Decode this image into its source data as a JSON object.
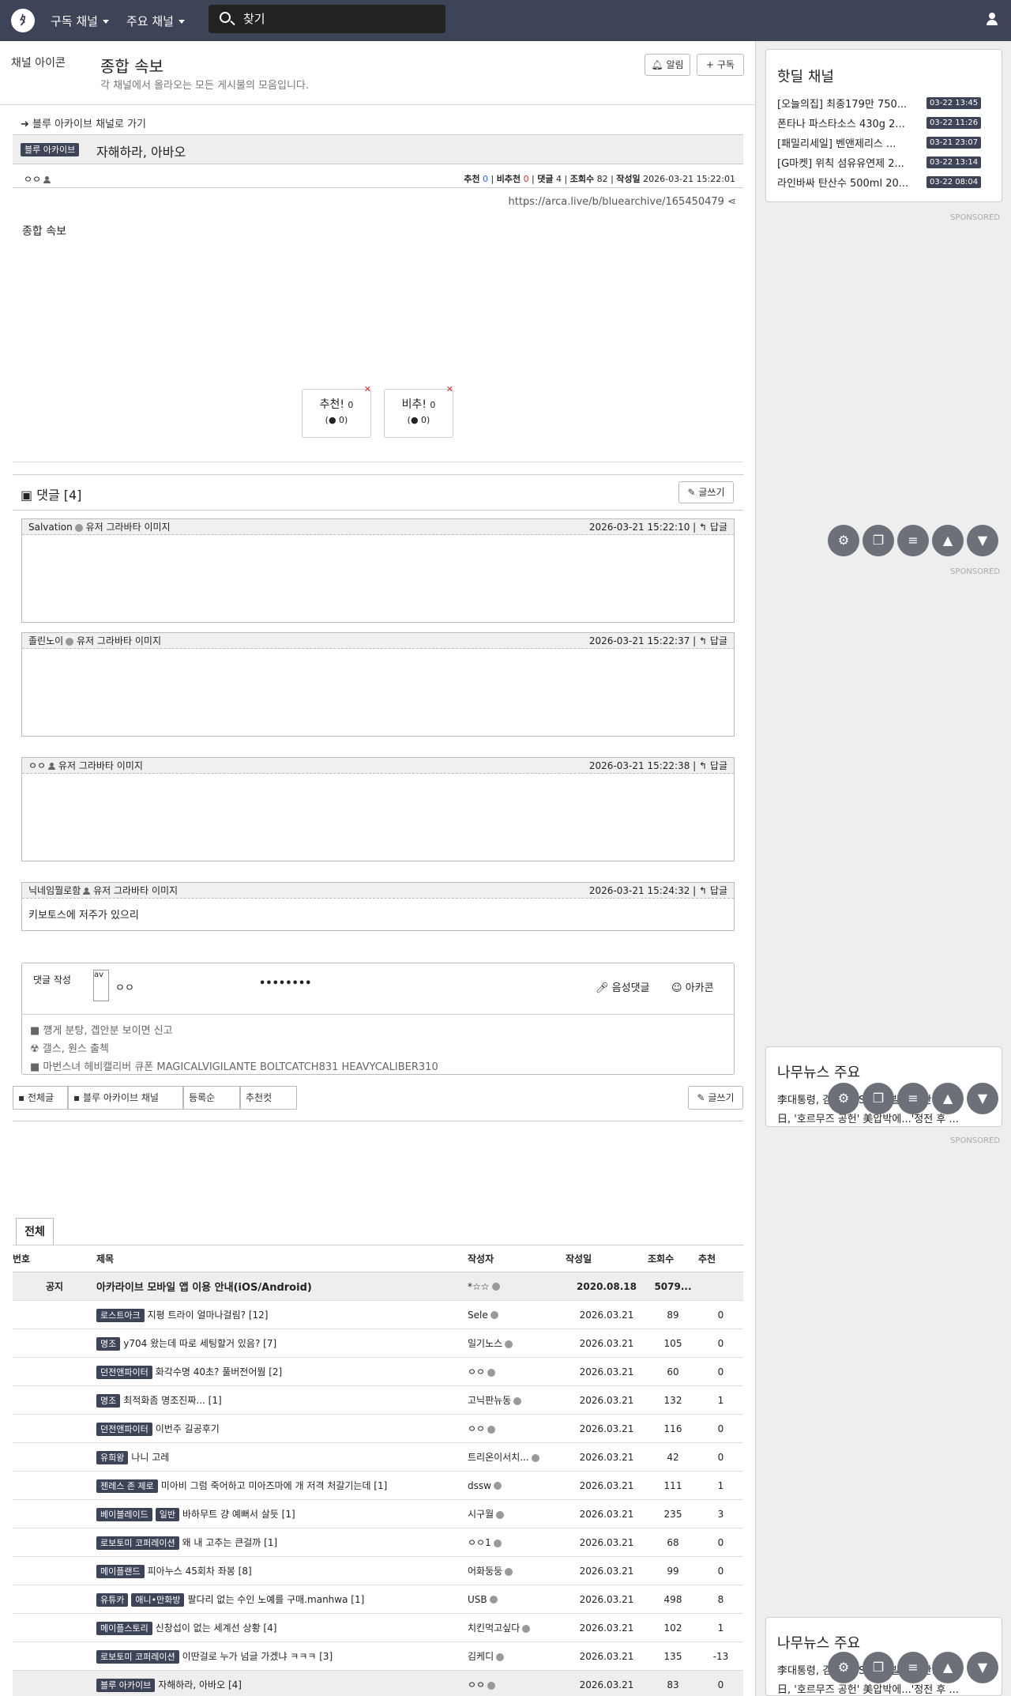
{
  "nav": {
    "menu1": "구독 채널",
    "menu2": "주요 채널",
    "search_placeholder": "찾기"
  },
  "board": {
    "channel_icon_alt": "채널 아이콘",
    "title": "종합 속보",
    "desc": "각 채널에서 올라오는 모든 게시물의 모음입니다.",
    "alarm": "알림",
    "subscribe": "구독"
  },
  "post": {
    "goto": "블루 아카이브 채널로 가기",
    "category": "블루 아카이브",
    "title": "자해하라, 아바오",
    "author": "ㅇㅇ",
    "stats": {
      "rec_label": "추천",
      "rec": "0",
      "unrec_label": "비추천",
      "unrec": "0",
      "comments_label": "댓글",
      "comments": "4",
      "views_label": "조회수",
      "views": "82",
      "date_label": "작성일",
      "date": "2026-03-21 15:22:01"
    },
    "url": "https://arca.live/b/bluearchive/165450479",
    "image_alt": "종합 속보",
    "vote_up": "추천!",
    "vote_up_count": "0",
    "vote_up_sub": "0",
    "vote_down": "비추!",
    "vote_down_count": "0",
    "vote_down_sub": "0"
  },
  "comments": {
    "header": "댓글 [4]",
    "write": "글쓰기",
    "items": [
      {
        "author": "Salvation",
        "avatar_alt": "유저 그라바타 이미지",
        "date": "2026-03-21 15:22:10",
        "reply": "답글",
        "body": ""
      },
      {
        "author": "졸린노이",
        "avatar_alt": "유저 그라바타 이미지",
        "date": "2026-03-21 15:22:37",
        "reply": "답글",
        "body": ""
      },
      {
        "author": "ㅇㅇ",
        "avatar_alt": "유저 그라바타 이미지",
        "date": "2026-03-21 15:22:38",
        "reply": "답글",
        "body": ""
      },
      {
        "author": "닉네임뭘로함",
        "avatar_alt": "유저 그라바타 이미지",
        "date": "2026-03-21 15:24:32",
        "reply": "답글",
        "body": "키보토스에 저주가 있으리"
      }
    ],
    "composer": {
      "label": "댓글 작성",
      "avatar_alt": "av",
      "nick": "ㅇㅇ",
      "password": "••••••••",
      "voice": "음성댓글",
      "arcacon": "아카콘",
      "rules": [
        "■ 꺵게 분탕, 곕안분 보이면 신고",
        "☢ 갤스, 원스 출첵",
        "■ 마번스녀 헤비캘리버 큐폰 MAGICALVIGILANTE BOLTCATCH831 HEAVYCALIBER310"
      ]
    }
  },
  "list_tabs": {
    "all": "전체글",
    "channel": "블루 아카이브 채널",
    "sort": "등록순",
    "best": "추천컷",
    "write": "글쓰기"
  },
  "list": {
    "tab": "전체",
    "headers": {
      "no": "번호",
      "title": "제목",
      "author": "작성자",
      "date": "작성일",
      "views": "조회수",
      "rec": "추천"
    },
    "rows": [
      {
        "no": "공지",
        "badges": [],
        "title": "아카라이브 모바일 앱 이용 안내(iOS/Android)",
        "author": "*☆☆",
        "date": "2020.08.18",
        "views": "5079...",
        "rec": ""
      },
      {
        "no": "",
        "badges": [
          "로스트아크"
        ],
        "title": "지평 트라이 얼마나걸림? [12]",
        "author": "Sele",
        "date": "2026.03.21",
        "views": "89",
        "rec": "0"
      },
      {
        "no": "",
        "badges": [
          "명조"
        ],
        "title": "y704 왔는데 따로 세팅할거 있음? [7]",
        "author": "일기노스",
        "date": "2026.03.21",
        "views": "105",
        "rec": "0"
      },
      {
        "no": "",
        "badges": [
          "던전앤파이터"
        ],
        "title": "화각수명 40초? 풀버전어뭠 [2]",
        "author": "ㅇㅇ",
        "date": "2026.03.21",
        "views": "60",
        "rec": "0"
      },
      {
        "no": "",
        "badges": [
          "명조"
        ],
        "title": "최적화좀 명조진짜... [1]",
        "author": "고닉판뉴동",
        "date": "2026.03.21",
        "views": "132",
        "rec": "1"
      },
      {
        "no": "",
        "badges": [
          "던전앤파이터"
        ],
        "title": "이번주 길공후기",
        "author": "ㅇㅇ",
        "date": "2026.03.21",
        "views": "116",
        "rec": "0"
      },
      {
        "no": "",
        "badges": [
          "유희왕"
        ],
        "title": "나니 고레",
        "author": "트리온이서치...",
        "date": "2026.03.21",
        "views": "42",
        "rec": "0"
      },
      {
        "no": "",
        "badges": [
          "젠레스 존 제로"
        ],
        "title": "미아비 그럼 죽어하고 미아즈마에 개 저격 처갈기는데 [1]",
        "author": "dssw",
        "date": "2026.03.21",
        "views": "111",
        "rec": "1"
      },
      {
        "no": "",
        "badges": [
          "베이블레이드",
          "일반"
        ],
        "title": "바하무트 걍 예뻐서 살듯 [1]",
        "author": "시구월",
        "date": "2026.03.21",
        "views": "235",
        "rec": "3"
      },
      {
        "no": "",
        "badges": [
          "로보토미 코퍼레이션"
        ],
        "title": "왜 내 고추는 큰걸까 [1]",
        "author": "ㅇㅇ1",
        "date": "2026.03.21",
        "views": "68",
        "rec": "0"
      },
      {
        "no": "",
        "badges": [
          "메이플랜드"
        ],
        "title": "피아누스 45회차 좌봉 [8]",
        "author": "어화둥둥",
        "date": "2026.03.21",
        "views": "99",
        "rec": "0"
      },
      {
        "no": "",
        "badges": [
          "유튜카",
          "애니•만화방"
        ],
        "title": "팔다리 없는 수인 노예를 구매.manhwa [1]",
        "author": "USB",
        "date": "2026.03.21",
        "views": "498",
        "rec": "8"
      },
      {
        "no": "",
        "badges": [
          "메이플스토리"
        ],
        "title": "신창섭이 없는 세계선 상황 [4]",
        "author": "치킨먹고싶다",
        "date": "2026.03.21",
        "views": "102",
        "rec": "1"
      },
      {
        "no": "",
        "badges": [
          "로보토미 코퍼레이션"
        ],
        "title": "이딴걸로 누가 넘글 가겠냐 ㅋㅋㅋ [3]",
        "author": "김케디",
        "date": "2026.03.21",
        "views": "135",
        "rec": "-13"
      },
      {
        "no": "",
        "badges": [
          "블루 아카이브"
        ],
        "title": "자해하라, 아바오 [4]",
        "author": "ㅇㅇ",
        "date": "2026.03.21",
        "views": "83",
        "rec": "0"
      }
    ]
  },
  "sidebar": {
    "hot_title": "핫딜 채널",
    "hot": [
      {
        "title": "[오늘의집] 최종179만 750...",
        "time": "03-22 13:45"
      },
      {
        "title": "폰타나 파스타소스 430g 2...",
        "time": "03-22 11:26"
      },
      {
        "title": "[패밀리세일] 벤앤제리스 ...",
        "time": "03-21 23:07"
      },
      {
        "title": "[G마켓] 위칙 섬유유연제 2...",
        "time": "03-22 13:14"
      },
      {
        "title": "라인바싸 탄산수 500ml 20...",
        "time": "03-22 08:04"
      }
    ],
    "sponsored": "SPONSORED",
    "news_title": "나무뉴스 주요",
    "news_line1": "李대통령, 검찰 SNS 조작 발언 논란...",
    "news_line2": "日, '호르무즈 공헌' 美압박에...'정전 후 ..."
  }
}
